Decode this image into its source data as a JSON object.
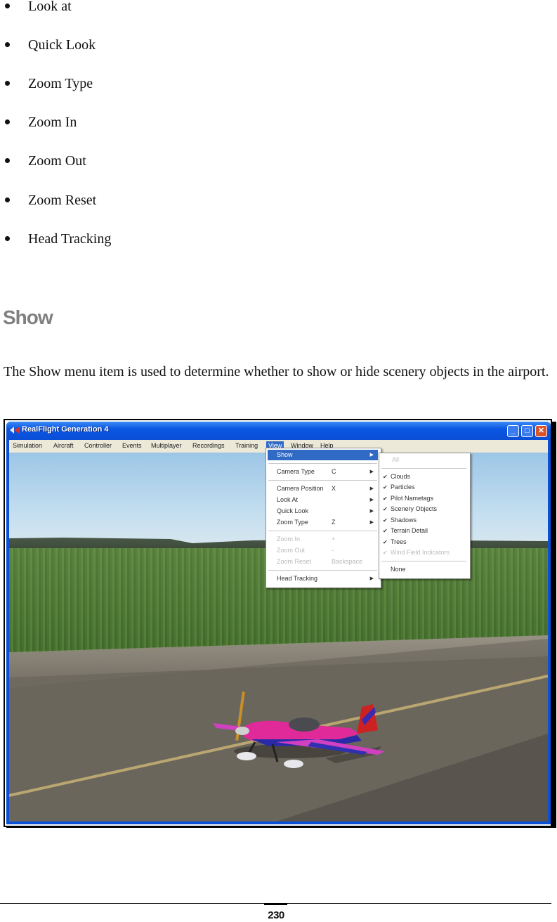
{
  "bullets": [
    "Look at",
    "Quick Look",
    "Zoom Type",
    "Zoom In",
    "Zoom Out",
    "Zoom Reset",
    "Head Tracking"
  ],
  "section": {
    "title": "Show",
    "paragraph": "The Show menu item is used to determine whether to show or hide scenery objects in the airport."
  },
  "screenshot": {
    "window_title": "RealFlight Generation 4",
    "titlebar_buttons": {
      "minimize": "_",
      "maximize": "□",
      "close": "✕"
    },
    "menubar": [
      "Simulation",
      "Aircraft",
      "Controller",
      "Events",
      "Multiplayer",
      "Recordings",
      "Training",
      "View",
      "Window",
      "Help"
    ],
    "active_menu": "View",
    "view_menu": [
      {
        "label": "Show",
        "accel": "",
        "submenu": true,
        "highlighted": true,
        "disabled": false
      },
      {
        "separator": true
      },
      {
        "label": "Camera Type",
        "accel": "C",
        "submenu": true,
        "disabled": false
      },
      {
        "separator": true
      },
      {
        "label": "Camera Position",
        "accel": "X",
        "submenu": true,
        "disabled": false
      },
      {
        "label": "Look At",
        "accel": "",
        "submenu": true,
        "disabled": false
      },
      {
        "label": "Quick Look",
        "accel": "",
        "submenu": true,
        "disabled": false
      },
      {
        "label": "Zoom Type",
        "accel": "Z",
        "submenu": true,
        "disabled": false
      },
      {
        "separator": true
      },
      {
        "label": "Zoom In",
        "accel": "+",
        "submenu": false,
        "disabled": true
      },
      {
        "label": "Zoom Out",
        "accel": "-",
        "submenu": false,
        "disabled": true
      },
      {
        "label": "Zoom Reset",
        "accel": "Backspace",
        "submenu": false,
        "disabled": true
      },
      {
        "separator": true
      },
      {
        "label": "Head Tracking",
        "accel": "",
        "submenu": true,
        "disabled": false
      }
    ],
    "show_submenu": [
      {
        "label": "All",
        "checked": false,
        "disabled": true
      },
      {
        "separator": true
      },
      {
        "label": "Clouds",
        "checked": true,
        "disabled": false
      },
      {
        "label": "Particles",
        "checked": true,
        "disabled": false
      },
      {
        "label": "Pilot Nametags",
        "checked": true,
        "disabled": false
      },
      {
        "label": "Scenery Objects",
        "checked": true,
        "disabled": false
      },
      {
        "label": "Shadows",
        "checked": true,
        "disabled": false
      },
      {
        "label": "Terrain Detail",
        "checked": true,
        "disabled": false
      },
      {
        "label": "Trees",
        "checked": true,
        "disabled": false
      },
      {
        "label": "Wind Field Indicators",
        "checked": true,
        "disabled": true
      },
      {
        "separator": true
      },
      {
        "label": "None",
        "checked": false,
        "disabled": false
      }
    ],
    "check_glyph": "✔",
    "submenu_arrow": "▶",
    "colors": {
      "titlebar": "#0b57e3",
      "menu_highlight": "#316ac5",
      "close_button": "#d9542c",
      "menubar_bg": "#ece9d8"
    }
  },
  "footer": {
    "page_number": "230"
  }
}
